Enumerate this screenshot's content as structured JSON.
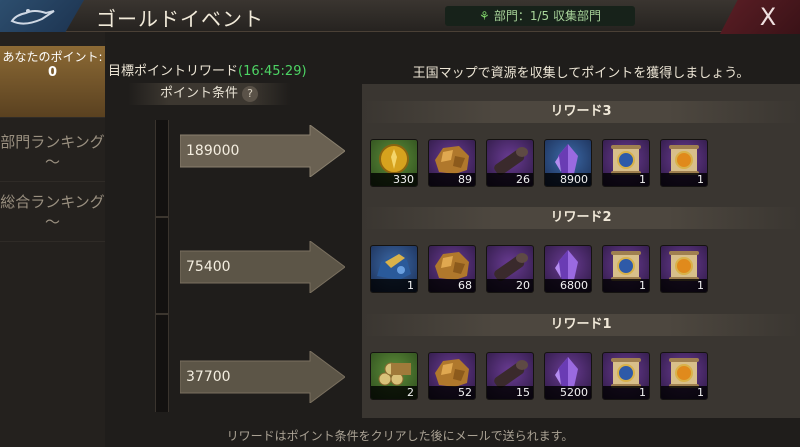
{
  "header": {
    "title": "ゴールドイベント",
    "dept_status": "部門：1/5 収集部門",
    "close_label": "X"
  },
  "sidebar": {
    "points_label": "あなたのポイント:",
    "points_value": "0",
    "dept_ranking": "部門ランキング～",
    "total_ranking": "総合ランキング～"
  },
  "target": {
    "label": "目標ポイントリワード",
    "timer": "(16:45:29)",
    "condition_label": "ポイント条件",
    "help_icon": "?"
  },
  "intro": "王国マップで資源を収集してポイントを獲得しましょう。",
  "tiers": [
    {
      "title": "リワード3",
      "points": "189000",
      "items": [
        {
          "icon": "gold-coin-icon",
          "color": "green",
          "qty": "330"
        },
        {
          "icon": "ore-icon",
          "color": "purple",
          "qty": "89"
        },
        {
          "icon": "wood-log-icon",
          "color": "purple",
          "qty": "26"
        },
        {
          "icon": "crystal-icon",
          "color": "blue",
          "qty": "8900"
        },
        {
          "icon": "scroll-blue-seal-icon",
          "color": "purple",
          "qty": "1"
        },
        {
          "icon": "scroll-orange-seal-icon",
          "color": "purple",
          "qty": "1"
        }
      ]
    },
    {
      "title": "リワード2",
      "points": "75400",
      "items": [
        {
          "icon": "mineral-rock-icon",
          "color": "blue",
          "qty": "1"
        },
        {
          "icon": "ore-icon",
          "color": "purple",
          "qty": "68"
        },
        {
          "icon": "wood-log-icon",
          "color": "purple",
          "qty": "20"
        },
        {
          "icon": "crystal-icon",
          "color": "purple",
          "qty": "6800"
        },
        {
          "icon": "scroll-blue-seal-icon",
          "color": "purple",
          "qty": "1"
        },
        {
          "icon": "scroll-orange-seal-icon",
          "color": "purple",
          "qty": "1"
        }
      ]
    },
    {
      "title": "リワード1",
      "points": "37700",
      "items": [
        {
          "icon": "lumber-pile-icon",
          "color": "green",
          "qty": "2"
        },
        {
          "icon": "ore-icon",
          "color": "purple",
          "qty": "52"
        },
        {
          "icon": "wood-log-icon",
          "color": "purple",
          "qty": "15"
        },
        {
          "icon": "crystal-icon",
          "color": "purple",
          "qty": "5200"
        },
        {
          "icon": "scroll-blue-seal-icon",
          "color": "purple",
          "qty": "1"
        },
        {
          "icon": "scroll-orange-seal-icon",
          "color": "purple",
          "qty": "1"
        }
      ]
    }
  ],
  "footer": "リワードはポイント条件をクリアした後にメールで送られます。"
}
